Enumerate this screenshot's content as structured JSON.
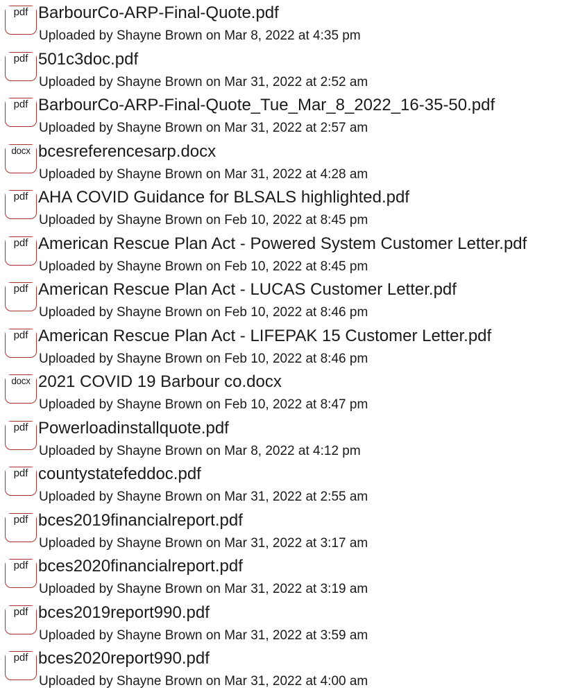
{
  "files": [
    {
      "ext": "pdf",
      "name": "BarbourCo-ARP-Final-Quote.pdf",
      "meta": "Uploaded by Shayne Brown on Mar 8, 2022 at 4:35 pm"
    },
    {
      "ext": "pdf",
      "name": "501c3doc.pdf",
      "meta": "Uploaded by Shayne Brown on Mar 31, 2022 at 2:52 am"
    },
    {
      "ext": "pdf",
      "name": "BarbourCo-ARP-Final-Quote_Tue_Mar_8_2022_16-35-50.pdf",
      "meta": "Uploaded by Shayne Brown on Mar 31, 2022 at 2:57 am"
    },
    {
      "ext": "docx",
      "name": "bcesreferencesarp.docx",
      "meta": "Uploaded by Shayne Brown on Mar 31, 2022 at 4:28 am"
    },
    {
      "ext": "pdf",
      "name": "AHA COVID Guidance for BLSALS highlighted.pdf",
      "meta": "Uploaded by Shayne Brown on Feb 10, 2022 at 8:45 pm"
    },
    {
      "ext": "pdf",
      "name": "American Rescue Plan Act - Powered System Customer Letter.pdf",
      "meta": "Uploaded by Shayne Brown on Feb 10, 2022 at 8:45 pm"
    },
    {
      "ext": "pdf",
      "name": "American Rescue Plan Act - LUCAS Customer Letter.pdf",
      "meta": "Uploaded by Shayne Brown on Feb 10, 2022 at 8:46 pm"
    },
    {
      "ext": "pdf",
      "name": "American Rescue Plan Act - LIFEPAK 15 Customer Letter.pdf",
      "meta": "Uploaded by Shayne Brown on Feb 10, 2022 at 8:46 pm"
    },
    {
      "ext": "docx",
      "name": "2021 COVID 19 Barbour co.docx",
      "meta": "Uploaded by Shayne Brown on Feb 10, 2022 at 8:47 pm"
    },
    {
      "ext": "pdf",
      "name": "Powerloadinstallquote.pdf",
      "meta": "Uploaded by Shayne Brown on Mar 8, 2022 at 4:12 pm"
    },
    {
      "ext": "pdf",
      "name": "countystatefeddoc.pdf",
      "meta": "Uploaded by Shayne Brown on Mar 31, 2022 at 2:55 am"
    },
    {
      "ext": "pdf",
      "name": "bces2019financialreport.pdf",
      "meta": "Uploaded by Shayne Brown on Mar 31, 2022 at 3:17 am"
    },
    {
      "ext": "pdf",
      "name": "bces2020financialreport.pdf",
      "meta": "Uploaded by Shayne Brown on Mar 31, 2022 at 3:19 am"
    },
    {
      "ext": "pdf",
      "name": "bces2019report990.pdf",
      "meta": "Uploaded by Shayne Brown on Mar 31, 2022 at 3:59 am"
    },
    {
      "ext": "pdf",
      "name": "bces2020report990.pdf",
      "meta": "Uploaded by Shayne Brown on Mar 31, 2022 at 4:00 am"
    }
  ],
  "colors": {
    "icon_border": "#a8332c",
    "text": "#1a1a1a"
  }
}
